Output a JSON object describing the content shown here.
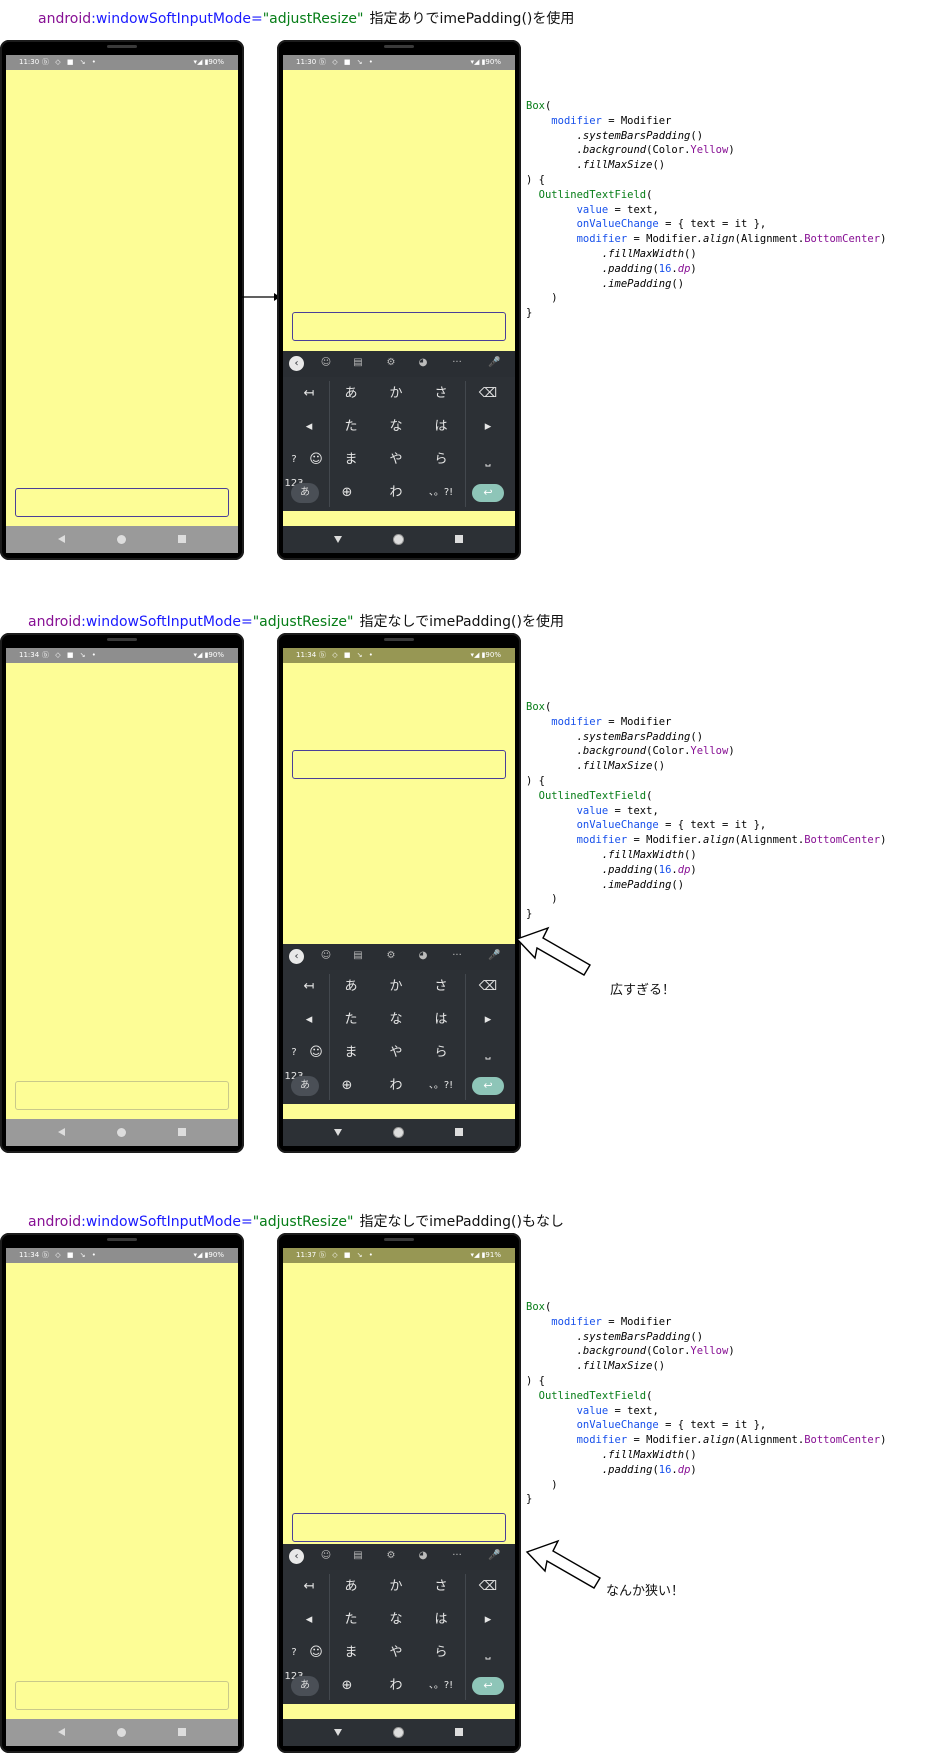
{
  "heading": {
    "attr": "android",
    "name": ":windowSoftInputMode=",
    "value": "\"adjustResize\"",
    "notes": [
      "指定ありでimePadding()を使用",
      "指定なしでimePadding()を使用",
      "指定なしでimePadding()もなし"
    ]
  },
  "status": {
    "times": [
      "11:30",
      "11:30",
      "11:34",
      "11:34",
      "11:34",
      "11:37"
    ],
    "icons": "ⓑ ◇ ■ ↘ •",
    "battery": [
      "▾◢ ▮90%",
      "▾◢ ▮90%",
      "▾◢ ▮90%",
      "▾◢ ▮90%",
      "▾◢ ▮90%",
      "▾◢ ▮91%"
    ]
  },
  "keyboard": {
    "toolbar": [
      "‹",
      "☺",
      "▤",
      "⚙",
      "◕",
      "···",
      "🎤"
    ],
    "rows": [
      [
        "↤",
        "あ",
        "か",
        "さ",
        "⌫"
      ],
      [
        "◂",
        "た",
        "な",
        "は",
        "▸"
      ],
      [
        "?123",
        "☺",
        "ま",
        "や",
        "ら",
        "⎵"
      ],
      [
        "あ",
        "⊕",
        "わ",
        "、。?!",
        "↩"
      ]
    ]
  },
  "code": {
    "box": "Box",
    "modifier_kw": "modifier",
    "eq": " = ",
    "Modifier": "Modifier",
    "systemBarsPadding": ".systemBarsPadding",
    "background": ".background",
    "Color": "Color",
    "Yellow": "Yellow",
    "fillMaxSize": ".fillMaxSize",
    "otf": "OutlinedTextField",
    "value_kw": "value",
    "text": "text",
    "onValueChange_kw": "onValueChange",
    "lambda": "{ text = it },",
    "align": ".align",
    "Alignment": "Alignment",
    "BottomCenter": "BottomCenter",
    "fillMaxWidth": ".fillMaxWidth",
    "padding": ".padding",
    "sixteen": "16",
    "dp": "dp",
    "imePadding": ".imePadding"
  },
  "comments": {
    "too_wide": "広すぎる！",
    "too_narrow": "なんか狭い！"
  },
  "colors": {
    "screen_yellow": "#fdfd96",
    "keyboard_dark": "#2c3035",
    "field_border": "#4a3f99"
  }
}
